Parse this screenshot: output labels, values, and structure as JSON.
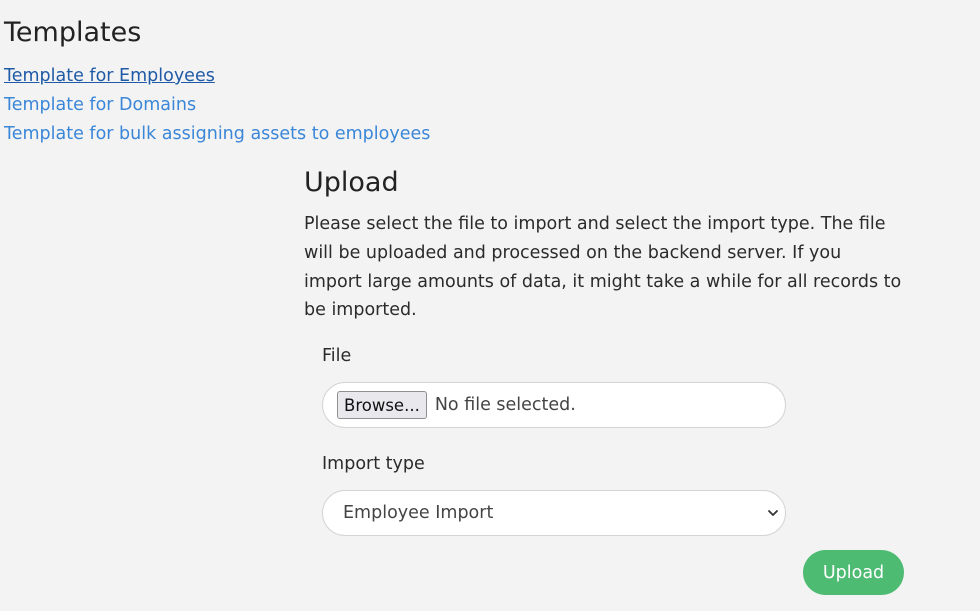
{
  "templates": {
    "title": "Templates",
    "links": [
      {
        "label": "Template for Employees"
      },
      {
        "label": "Template for Domains"
      },
      {
        "label": "Template for bulk assigning assets to employees"
      }
    ]
  },
  "upload": {
    "title": "Upload",
    "description": "Please select the file to import and select the import type. The file will be uploaded and processed on the backend server. If you import large amounts of data, it might take a while for all records to be imported.",
    "file_label": "File",
    "browse_label": "Browse...",
    "file_status": "No file selected.",
    "import_type_label": "Import type",
    "import_type_value": "Employee Import",
    "submit_label": "Upload"
  },
  "icons": {
    "select_chevron": "chevron-down-icon"
  },
  "colors": {
    "background": "#f3f3f3",
    "link": "#3a86d8",
    "link_visited": "#1f5aa6",
    "upload_button": "#4dbb72"
  }
}
